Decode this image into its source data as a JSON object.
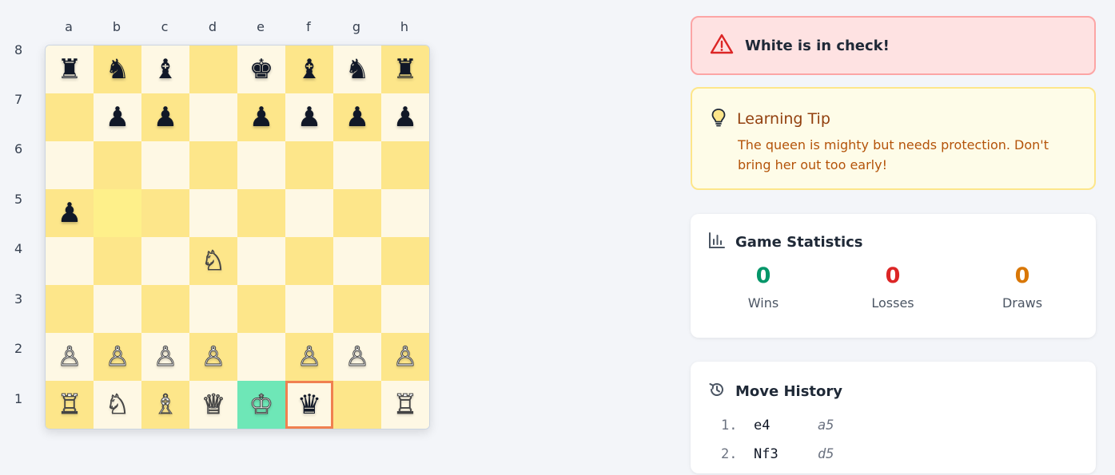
{
  "board": {
    "files": [
      "a",
      "b",
      "c",
      "d",
      "e",
      "f",
      "g",
      "h"
    ],
    "ranks": [
      "8",
      "7",
      "6",
      "5",
      "4",
      "3",
      "2",
      "1"
    ],
    "squares": [
      [
        "♜",
        "♞",
        "♝",
        "",
        "♚",
        "♝",
        "♞",
        "♜"
      ],
      [
        "",
        "♟",
        "♟",
        "",
        "♟",
        "♟",
        "♟",
        "♟"
      ],
      [
        "",
        "",
        "",
        "",
        "",
        "",
        "",
        ""
      ],
      [
        "♟",
        "",
        "",
        "",
        "",
        "",
        "",
        ""
      ],
      [
        "",
        "",
        "",
        "♘",
        "",
        "",
        "",
        ""
      ],
      [
        "",
        "",
        "",
        "",
        "",
        "",
        "",
        ""
      ],
      [
        "♙",
        "♙",
        "♙",
        "♙",
        "",
        "♙",
        "♙",
        "♙"
      ],
      [
        "♖",
        "♘",
        "♗",
        "♕",
        "♔",
        "♛",
        "",
        "♖"
      ]
    ],
    "colors": {
      "light": "#fef8e4",
      "dark": "#fde68a",
      "last_move_from": "#fef08a",
      "selected": "#6ee7b7",
      "check_outline": "#f08050"
    }
  },
  "alert": {
    "icon": "warning-triangle-icon",
    "title": "White is in check!"
  },
  "tip": {
    "icon": "lightbulb-icon",
    "title": "Learning Tip",
    "body": "The queen is mighty but needs protection. Don't bring her out too early!"
  },
  "stats": {
    "icon": "bar-chart-icon",
    "title": "Game Statistics",
    "items": [
      {
        "value": "0",
        "label": "Wins",
        "color": "#059669"
      },
      {
        "value": "0",
        "label": "Losses",
        "color": "#dc2626"
      },
      {
        "value": "0",
        "label": "Draws",
        "color": "#d97706"
      }
    ]
  },
  "history": {
    "icon": "history-icon",
    "title": "Move History",
    "moves": [
      {
        "num": "1.",
        "white": "e4",
        "black": "a5"
      },
      {
        "num": "2.",
        "white": "Nf3",
        "black": "d5"
      }
    ]
  }
}
